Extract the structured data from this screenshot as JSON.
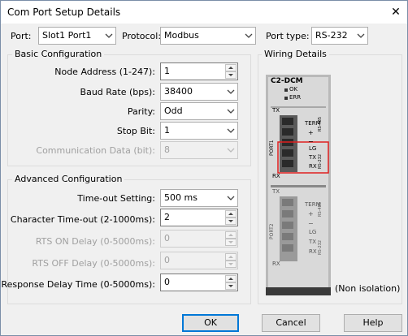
{
  "window": {
    "title": "Com Port Setup Details",
    "close_glyph": "✕"
  },
  "top": {
    "port_label": "Port:",
    "port_value": "Slot1 Port1",
    "protocol_label": "Protocol:",
    "protocol_value": "Modbus",
    "port_type_label": "Port type:",
    "port_type_value": "RS-232"
  },
  "basic": {
    "title": "Basic Configuration",
    "node_address": {
      "label": "Node Address (1-247):",
      "value": "1"
    },
    "baud_rate": {
      "label": "Baud Rate (bps):",
      "value": "38400"
    },
    "parity": {
      "label": "Parity:",
      "value": "Odd"
    },
    "stop_bit": {
      "label": "Stop Bit:",
      "value": "1"
    },
    "comm_data": {
      "label": "Communication Data (bit):",
      "value": "8"
    }
  },
  "advanced": {
    "title": "Advanced Configuration",
    "timeout": {
      "label": "Time-out Setting:",
      "value": "500 ms"
    },
    "char_timeout": {
      "label": "Character Time-out (2-1000ms):",
      "value": "2"
    },
    "rts_on": {
      "label": "RTS ON Delay (0-5000ms):",
      "value": "0"
    },
    "rts_off": {
      "label": "RTS OFF Delay (0-5000ms):",
      "value": "0"
    },
    "response_delay": {
      "label": "Response Delay Time (0-5000ms):",
      "value": "0"
    }
  },
  "wiring": {
    "title": "Wiring Details",
    "module_name": "C2-DCM",
    "led_ok": "OK",
    "led_err": "ERR",
    "port1_label": "PORT1",
    "port2_label": "PORT2",
    "tx": "TX",
    "rx": "RX",
    "term": "TERM",
    "plus": "+",
    "minus": "−",
    "lg": "LG",
    "tx2": "TX",
    "rx2": "RX",
    "rs485": "RS-485",
    "rs232": "RS-232",
    "isolation_note": "(Non isolation)",
    "highlight_color": "#e02020"
  },
  "buttons": {
    "ok": "OK",
    "cancel": "Cancel",
    "help": "Help"
  }
}
